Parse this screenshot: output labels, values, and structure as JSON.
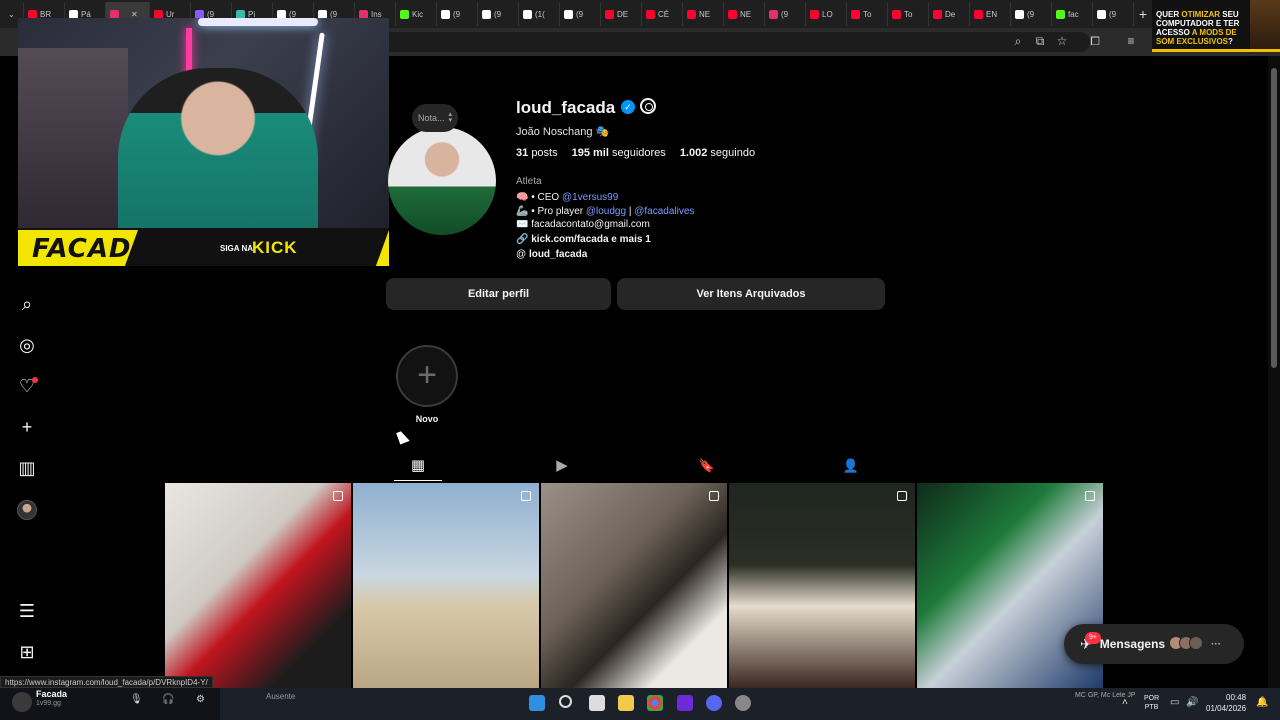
{
  "browser": {
    "tabs": [
      {
        "label": "BR",
        "color": "#ff0033"
      },
      {
        "label": "Pá",
        "color": "#ffffff"
      },
      {
        "label": "",
        "color": "#e1306c"
      },
      {
        "label": "Ur",
        "color": "#ff0033"
      },
      {
        "label": "(9",
        "color": "#8a5cff"
      },
      {
        "label": "Pi",
        "color": "#32bcad"
      },
      {
        "label": "(9",
        "color": "#ffffff"
      },
      {
        "label": "(9",
        "color": "#ffffff"
      },
      {
        "label": "Ins",
        "color": "#e1306c"
      },
      {
        "label": "Kic",
        "color": "#53fc18"
      },
      {
        "label": "(9",
        "color": "#ffffff"
      },
      {
        "label": "(9",
        "color": "#ffffff"
      },
      {
        "label": "(1(",
        "color": "#ffffff"
      },
      {
        "label": "(9",
        "color": "#ffffff"
      },
      {
        "label": "DE",
        "color": "#ff0033"
      },
      {
        "label": "CÉ",
        "color": "#ff0033"
      },
      {
        "label": "NE",
        "color": "#ff0033"
      },
      {
        "label": "NE",
        "color": "#ff0033"
      },
      {
        "label": "(9",
        "color": "#e1306c"
      },
      {
        "label": "LO",
        "color": "#ff0033"
      },
      {
        "label": "To",
        "color": "#ff0033"
      },
      {
        "label": "To",
        "color": "#ff0033"
      },
      {
        "label": "De",
        "color": "#ff0033"
      },
      {
        "label": "EN",
        "color": "#ff0033"
      },
      {
        "label": "(9",
        "color": "#ffffff"
      },
      {
        "label": "fac",
        "color": "#53fc18"
      },
      {
        "label": "(9",
        "color": "#ffffff"
      }
    ],
    "active_tab_close": "✕",
    "new_tab": "+"
  },
  "ad": {
    "line1": "QUER ",
    "highlight1": "OTIMIZAR",
    "line2": " SEU COMPUTADOR E TER ACESSO ",
    "highlight2": "A MODS DE SOM EXCLUSIVOS",
    "line3": "?"
  },
  "webcam": {
    "brand": "FACADA",
    "siga": "SIGA NA",
    "platform": "KICK"
  },
  "profile": {
    "note_label": "Nota...",
    "username": "loud_facada",
    "verified_mark": "✓",
    "full_name": "João Noschang 🎭",
    "posts_count": "31",
    "posts_label": "posts",
    "followers_count": "195 mil",
    "followers_label": "seguidores",
    "following_count": "1.002",
    "following_label": "seguindo",
    "category": "Atleta",
    "bio": {
      "line1_prefix": "🧠 • CEO ",
      "line1_link": "@1versus99",
      "line2_prefix": "🦾 • Pro player ",
      "line2_link1": "@loudgg",
      "line2_sep": " | ",
      "line2_link2": "@facadalives",
      "line3": "✉️ facadacontato@gmail.com",
      "link_icon": "🔗",
      "link_text": "kick.com/facada e mais 1",
      "threads_icon": "@",
      "threads_text": "loud_facada"
    },
    "edit_button": "Editar perfil",
    "archive_button": "Ver Itens Arquivados",
    "highlight_new_symbol": "+",
    "highlight_new_label": "Novo"
  },
  "tabs": {
    "posts_icon": "▦",
    "reels_icon": "▶",
    "saved_icon": "🔖",
    "tagged_icon": "👤"
  },
  "posts": [
    {
      "bg": "linear-gradient(135deg,#e9e6e2 0%,#cfcac4 40%,#c0151f 55%,#1c1c1c 80%)"
    },
    {
      "bg": "linear-gradient(180deg,#8fb0d0 0%,#c9d6e0 45%,#d8c9a8 60%,#b9a684 100%)"
    },
    {
      "bg": "linear-gradient(135deg,#9a9088 0%,#6c6258 40%,#2a2520 60%,#ece9e4 80%)"
    },
    {
      "bg": "linear-gradient(180deg,#1f2620 0%,#2b2f24 40%,#e6dccd 60%,#3a2820 100%)"
    },
    {
      "bg": "linear-gradient(135deg,#0f2a1a 0%,#1e7a3a 35%,#c8d0d8 55%,#1f3a6a 100%)"
    }
  ],
  "messages": {
    "label": "Mensagens",
    "badge": "9+",
    "more": "···"
  },
  "status_url": "https://www.instagram.com/loud_facada/p/DVRknpID4-Y/",
  "taskbar": {
    "discord_name": "Facada",
    "discord_status": "1v99.gg",
    "away": "Ausente",
    "now_playing": "MC GP, Mc Lele JP, DJ Boy, DOGDOG, Dj Andrabeat",
    "lang1": "POR",
    "lang2": "PTB",
    "time": "00:48",
    "date": "01/04/2026"
  }
}
